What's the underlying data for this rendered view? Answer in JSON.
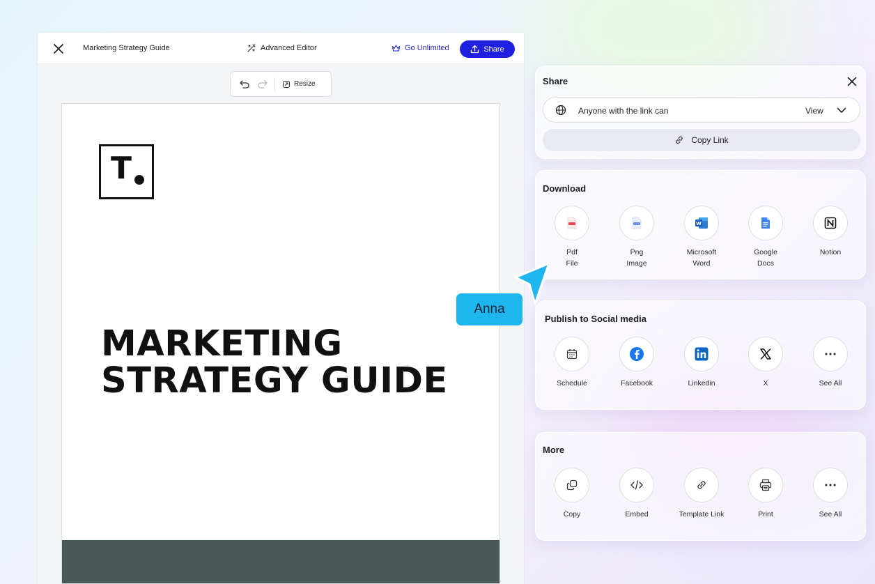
{
  "editor": {
    "doc_title": "Marketing Strategy Guide",
    "advanced_editor": "Advanced Editor",
    "go_unlimited": "Go Unlimited",
    "share_label": "Share",
    "resize_label": "Resize"
  },
  "page": {
    "logo_letter": "T",
    "headline_line1": "MARKETING",
    "headline_line2": "STRATEGY GUIDE"
  },
  "share_panel": {
    "title": "Share",
    "permission_text": "Anyone with the link can",
    "permission_value": "View",
    "copy_link": "Copy Link"
  },
  "download": {
    "title": "Download",
    "items": [
      {
        "label": "Pdf\nFile",
        "icon": "pdf-file-icon"
      },
      {
        "label": "Png\nImage",
        "icon": "png-image-icon"
      },
      {
        "label": "Microsoft\nWord",
        "icon": "word-icon"
      },
      {
        "label": "Google\nDocs",
        "icon": "google-docs-icon"
      },
      {
        "label": "Notion",
        "icon": "notion-icon"
      }
    ]
  },
  "social": {
    "title": "Publish to Social media",
    "items": [
      {
        "label": "Schedule",
        "icon": "calendar-icon"
      },
      {
        "label": "Facebook",
        "icon": "facebook-icon"
      },
      {
        "label": "Linkedin",
        "icon": "linkedin-icon"
      },
      {
        "label": "X",
        "icon": "x-icon"
      },
      {
        "label": "See All",
        "icon": "more-icon"
      }
    ]
  },
  "more": {
    "title": "More",
    "items": [
      {
        "label": "Copy",
        "icon": "copy-icon"
      },
      {
        "label": "Embed",
        "icon": "code-icon"
      },
      {
        "label": "Template Link",
        "icon": "link-icon"
      },
      {
        "label": "Print",
        "icon": "printer-icon"
      },
      {
        "label": "See All",
        "icon": "more-icon"
      }
    ]
  },
  "collaborator": {
    "name": "Anna",
    "color": "#1fb6f0"
  },
  "colors": {
    "accent": "#1f1fe0",
    "page_footer": "#4a5a59"
  }
}
